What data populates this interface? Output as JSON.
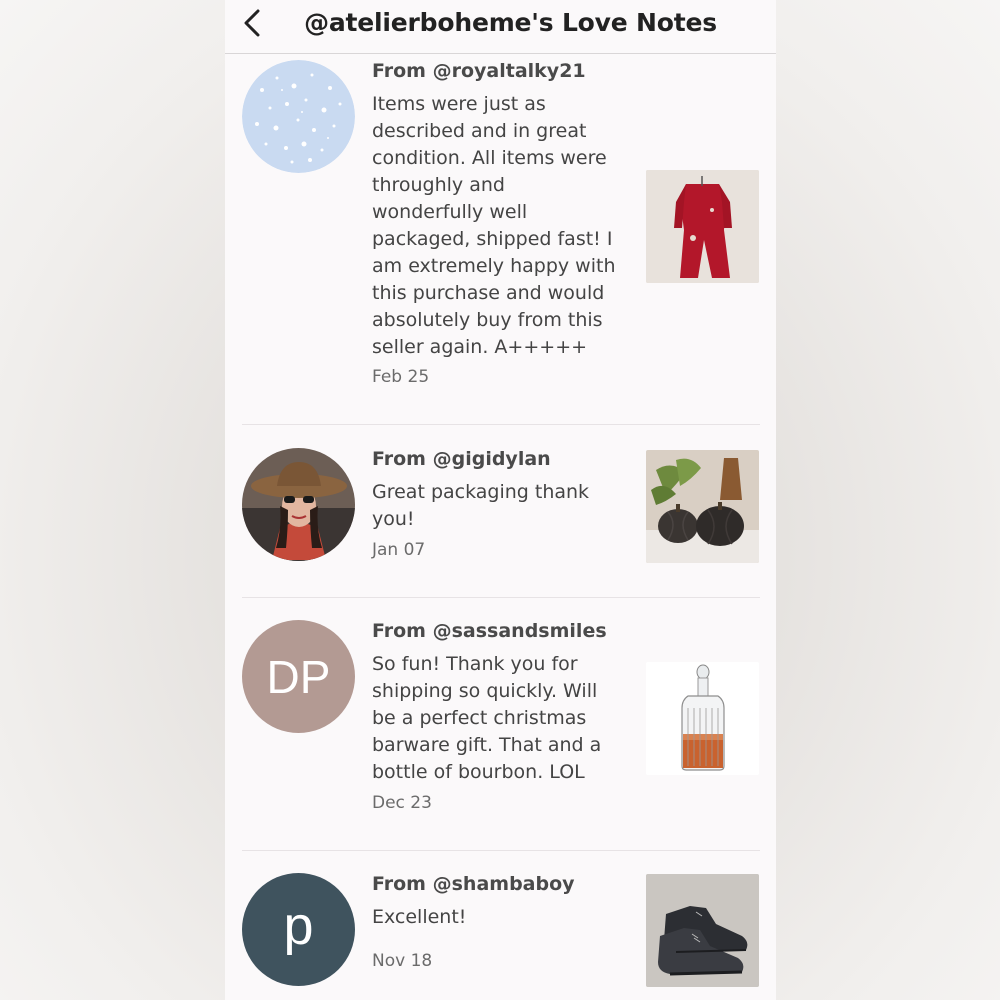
{
  "header": {
    "title": "@atelierboheme's Love Notes",
    "back_icon": "chevron-left-icon"
  },
  "notes": [
    {
      "from_prefix": "From ",
      "username": "@royaltalky21",
      "body": "Items were just as described and in great condition. All items were throughly and wonderfully well packaged, shipped fast! I am extremely happy with this purchase and would absolutely buy from this seller again. A+++++",
      "date": "Feb 25",
      "avatar_type": "pattern",
      "avatar_color": "#c9daf1",
      "thumb_subject": "red-outfit-photo"
    },
    {
      "from_prefix": "From ",
      "username": "@gigidylan",
      "body": "Great packaging thank you!",
      "date": "Jan 07",
      "avatar_type": "photo",
      "thumb_subject": "pumpkin-decor-photo"
    },
    {
      "from_prefix": "From ",
      "username": "@sassandsmiles",
      "body": "So fun! Thank you for shipping so quickly. Will be a perfect christmas barware gift. That and a bottle of bourbon. LOL",
      "date": "Dec 23",
      "avatar_type": "initials",
      "avatar_initials": "DP",
      "avatar_color": "#b39a93",
      "thumb_subject": "decanter-photo"
    },
    {
      "from_prefix": "From ",
      "username": "@shambaboy",
      "body": "Excellent!",
      "date": "Nov 18",
      "avatar_type": "initials",
      "avatar_initials": "p",
      "avatar_color": "#3f535e",
      "thumb_subject": "boots-photo"
    }
  ]
}
